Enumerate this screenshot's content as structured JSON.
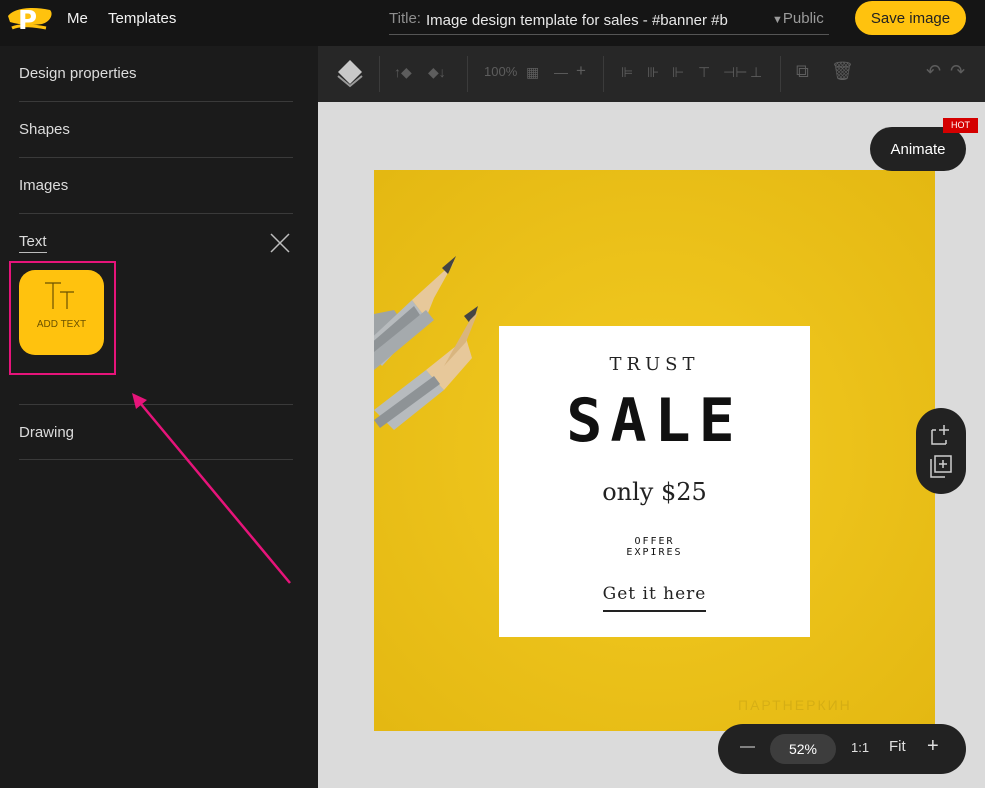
{
  "header": {
    "logo_letter": "P",
    "nav": [
      "Me",
      "Templates"
    ],
    "title_label": "Title:",
    "title_value": "Image design template for sales - #banner #b",
    "visibility": "Public",
    "save_label": "Save image"
  },
  "sidebar": {
    "items": [
      "Design properties",
      "Shapes",
      "Images",
      "Text",
      "Drawing"
    ],
    "add_text_label": "ADD TEXT"
  },
  "toolbar": {
    "zoom_text": "100%"
  },
  "canvas": {
    "trust": "TRUST",
    "sale": "SALE",
    "price": "only $25",
    "offer_line1": "OFFER",
    "offer_line2": "EXPIRES",
    "cta": "Get it here",
    "watermark": "ПАРТНЕРКИН"
  },
  "animate": {
    "label": "Animate",
    "badge": "HOT"
  },
  "zoom": {
    "minus": "—",
    "value": "52%",
    "ratio": "1:1",
    "fit": "Fit",
    "plus": "+"
  },
  "colors": {
    "accent": "#ffc20e",
    "highlight": "#e6147a",
    "artboard": "#efc51d"
  }
}
